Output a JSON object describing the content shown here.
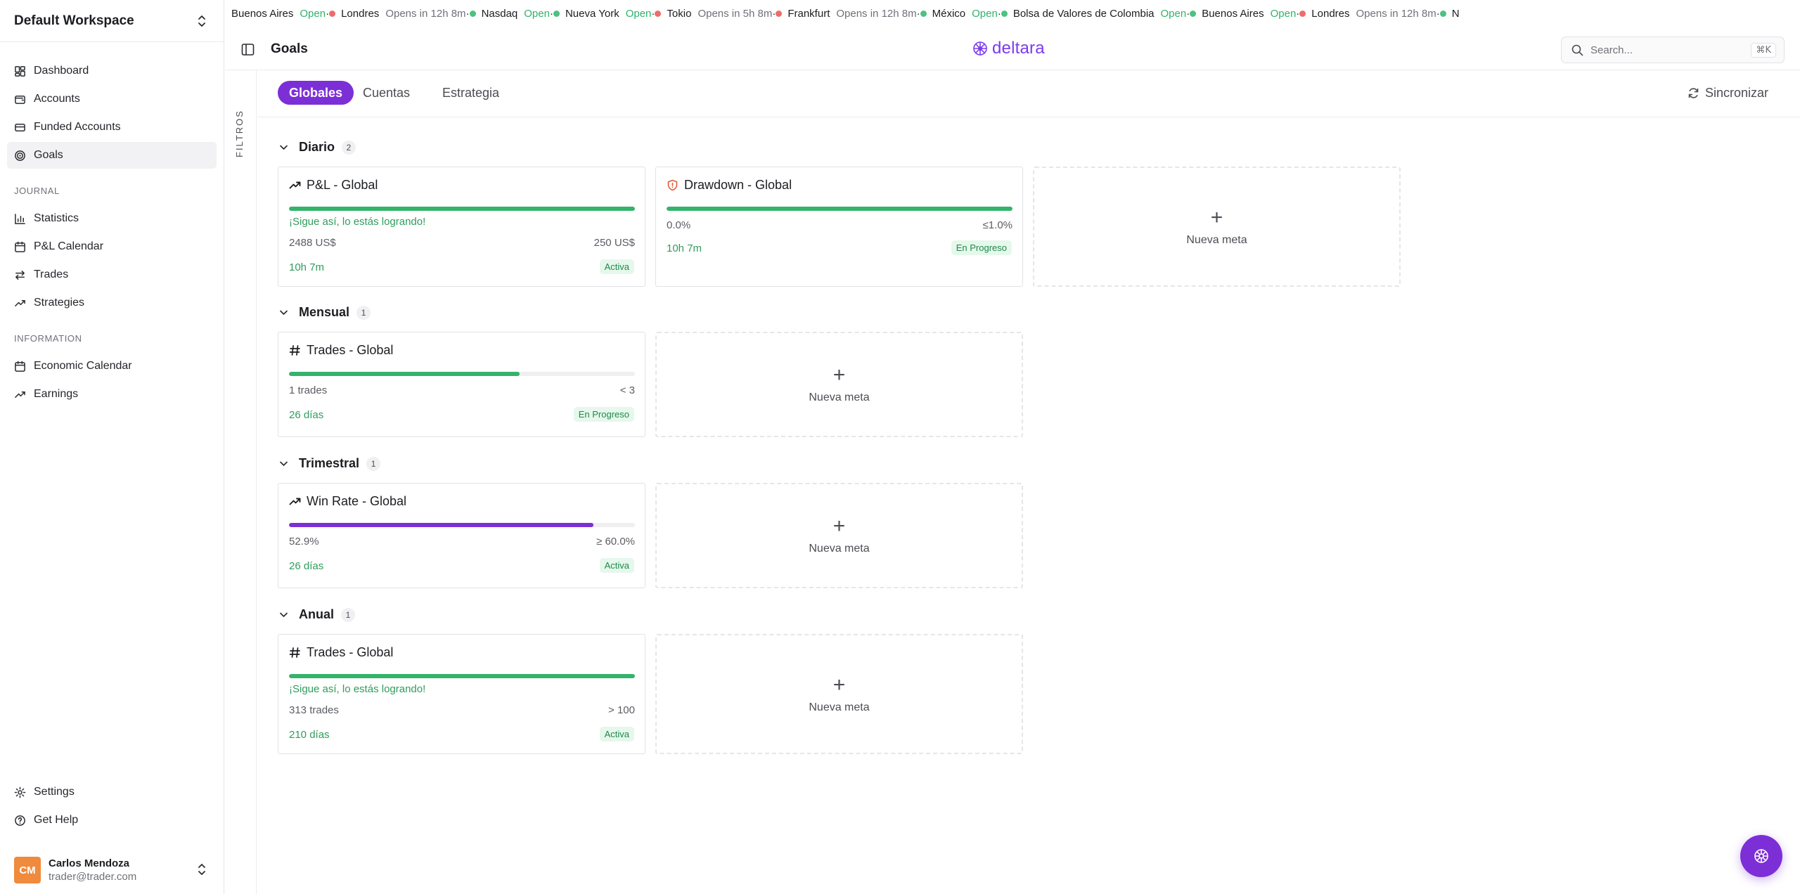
{
  "workspace": {
    "name": "Default Workspace"
  },
  "nav": {
    "main": [
      {
        "label": "Dashboard",
        "icon": "dashboard-icon"
      },
      {
        "label": "Accounts",
        "icon": "wallet-icon"
      },
      {
        "label": "Funded Accounts",
        "icon": "card-icon"
      },
      {
        "label": "Goals",
        "icon": "target-icon",
        "active": true
      }
    ],
    "journal_title": "JOURNAL",
    "journal": [
      {
        "label": "Statistics",
        "icon": "bar-chart-icon"
      },
      {
        "label": "P&L Calendar",
        "icon": "calendar-icon"
      },
      {
        "label": "Trades",
        "icon": "arrows-icon"
      },
      {
        "label": "Strategies",
        "icon": "trend-icon"
      }
    ],
    "information_title": "INFORMATION",
    "information": [
      {
        "label": "Economic Calendar",
        "icon": "calendar-icon"
      },
      {
        "label": "Earnings",
        "icon": "trend-icon"
      }
    ],
    "footer": [
      {
        "label": "Settings",
        "icon": "gear-icon"
      },
      {
        "label": "Get Help",
        "icon": "help-icon"
      }
    ]
  },
  "user": {
    "initials": "CM",
    "name": "Carlos Mendoza",
    "email": "trader@trader.com"
  },
  "ticker": [
    {
      "market": "Buenos Aires",
      "status": "Open",
      "open": true,
      "show_dot": false
    },
    {
      "market": "Londres",
      "status": "Opens in 12h 8m",
      "open": false,
      "show_dot": true
    },
    {
      "market": "Nasdaq",
      "status": "Open",
      "open": true,
      "show_dot": true
    },
    {
      "market": "Nueva York",
      "status": "Open",
      "open": true,
      "show_dot": true
    },
    {
      "market": "Tokio",
      "status": "Opens in 5h 8m",
      "open": false,
      "show_dot": true
    },
    {
      "market": "Frankfurt",
      "status": "Opens in 12h 8m",
      "open": false,
      "show_dot": true
    },
    {
      "market": "México",
      "status": "Open",
      "open": true,
      "show_dot": true
    },
    {
      "market": "Bolsa de Valores de Colombia",
      "status": "Open",
      "open": true,
      "show_dot": true
    },
    {
      "market": "Buenos Aires",
      "status": "Open",
      "open": true,
      "show_dot": true
    },
    {
      "market": "Londres",
      "status": "Opens in 12h 8m",
      "open": false,
      "show_dot": true
    },
    {
      "market": "N",
      "status": "",
      "open": true,
      "show_dot": true
    }
  ],
  "header": {
    "title": "Goals",
    "brand": "deltara",
    "search_placeholder": "Search...",
    "shortcut": "⌘K"
  },
  "filters_label": "FILTROS",
  "tabs": [
    {
      "label": "Globales",
      "active": true
    },
    {
      "label": "Cuentas",
      "active": false
    },
    {
      "label": "Estrategia",
      "active": false
    }
  ],
  "sync_label": "Sincronizar",
  "new_goal_label": "Nueva meta",
  "sections": [
    {
      "title": "Diario",
      "count": "2",
      "goals": [
        {
          "icon": "trend-up-icon",
          "title": "P&L - Global",
          "progress": 1.0,
          "bar_color": "#34b36b",
          "message": "¡Sigue así, lo estás logrando!",
          "current": "2488 US$",
          "target": "250 US$",
          "time": "10h 7m",
          "status": "Activa"
        },
        {
          "icon": "shield-icon",
          "title": "Drawdown - Global",
          "progress": 1.0,
          "bar_color": "#34b36b",
          "message": "",
          "current": "0.0%",
          "target": "≤1.0%",
          "time": "10h 7m",
          "status": "En Progreso"
        }
      ]
    },
    {
      "title": "Mensual",
      "count": "1",
      "goals": [
        {
          "icon": "hash-icon",
          "title": "Trades - Global",
          "progress": 0.667,
          "bar_color": "#34b36b",
          "message": "",
          "current": "1 trades",
          "target": "< 3",
          "time": "26 días",
          "status": "En Progreso"
        }
      ]
    },
    {
      "title": "Trimestral",
      "count": "1",
      "goals": [
        {
          "icon": "trend-up-icon",
          "title": "Win Rate - Global",
          "progress": 0.88,
          "bar_color": "#7c2fd6",
          "message": "",
          "current": "52.9%",
          "target": "≥ 60.0%",
          "time": "26 días",
          "status": "Activa"
        }
      ]
    },
    {
      "title": "Anual",
      "count": "1",
      "goals": [
        {
          "icon": "hash-icon",
          "title": "Trades - Global",
          "progress": 1.0,
          "bar_color": "#34b36b",
          "message": "¡Sigue así, lo estás logrando!",
          "current": "313 trades",
          "target": "> 100",
          "time": "210 días",
          "status": "Activa"
        }
      ]
    }
  ]
}
